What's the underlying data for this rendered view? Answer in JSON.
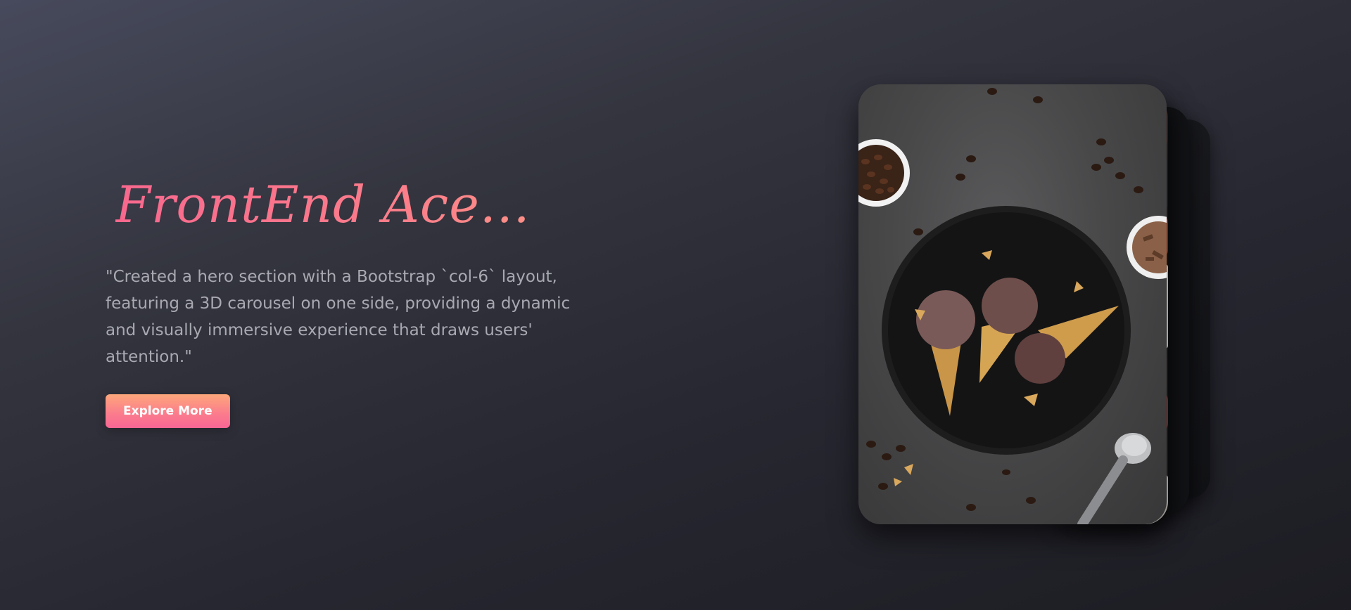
{
  "hero": {
    "title": "FrontEnd Ace...",
    "description": "\"Created a hero section with a Bootstrap `col-6` layout, featuring a 3D carousel on one side, providing a dynamic and visually immersive experience that draws users' attention.\"",
    "cta_label": "Explore More"
  },
  "carousel": {
    "active_slide_subject": "ice-cream-cones-photo"
  },
  "colors": {
    "accent_pink": "#f8688e",
    "accent_orange": "#fca77a",
    "background_dark": "#272731",
    "description_text": "#a8a9b1"
  }
}
